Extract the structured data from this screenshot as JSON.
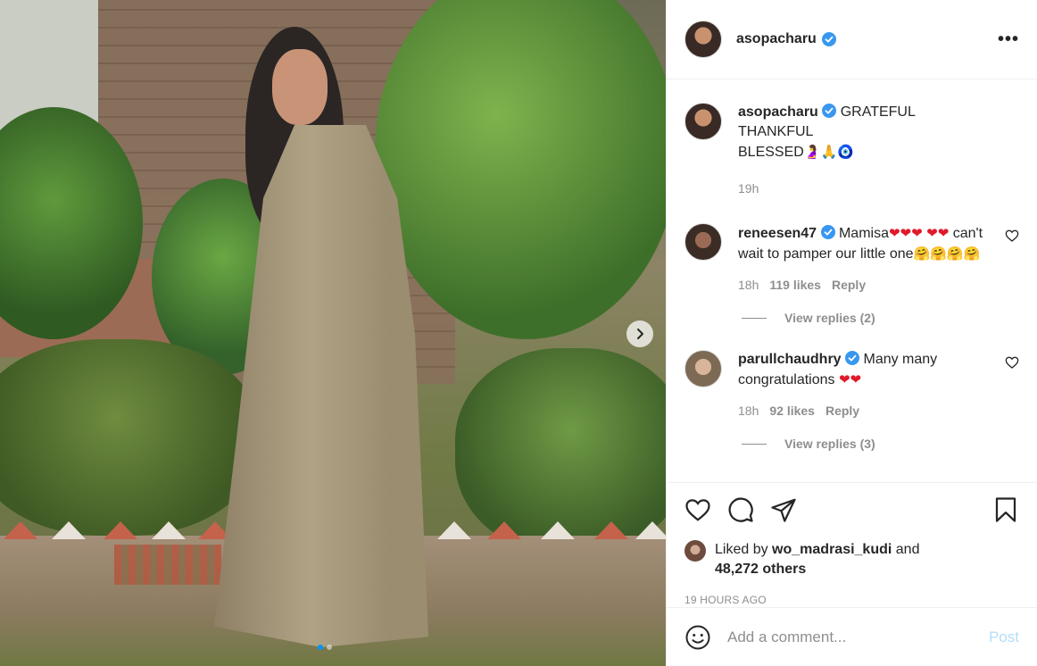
{
  "post": {
    "username": "asopacharu",
    "caption_lines": [
      "GRATEFUL",
      "THANKFUL",
      "BLESSED"
    ],
    "caption_emoji": "🤰🙏🧿",
    "caption_time": "19h",
    "more_icon": "•••"
  },
  "comments": [
    {
      "username": "reneesen47",
      "text_a": "Mamisa",
      "hearts_a": "❤❤❤",
      "hearts_b": "❤❤",
      "text_b": " can't wait to pamper our little one",
      "emoji_b": "🤗🤗🤗🤗",
      "time": "18h",
      "likes": "119 likes",
      "reply": "Reply",
      "view_replies": "View replies (2)"
    },
    {
      "username": "parullchaudhry",
      "text_a": "Many many congratulations",
      "hearts_a": "❤❤",
      "time": "18h",
      "likes": "92 likes",
      "reply": "Reply",
      "view_replies": "View replies (3)"
    }
  ],
  "likes": {
    "prefix": "Liked by",
    "user": "wo_madrasi_kudi",
    "and": "and",
    "others": "48,272 others"
  },
  "timestamp": "19 HOURS AGO",
  "comment_box": {
    "placeholder": "Add a comment...",
    "post_label": "Post"
  },
  "colors": {
    "verified": "#3897f0",
    "link_blue_disabled": "#b2dffc",
    "meta_gray": "#8e8e8e",
    "carousel_active": "#0095f6"
  }
}
